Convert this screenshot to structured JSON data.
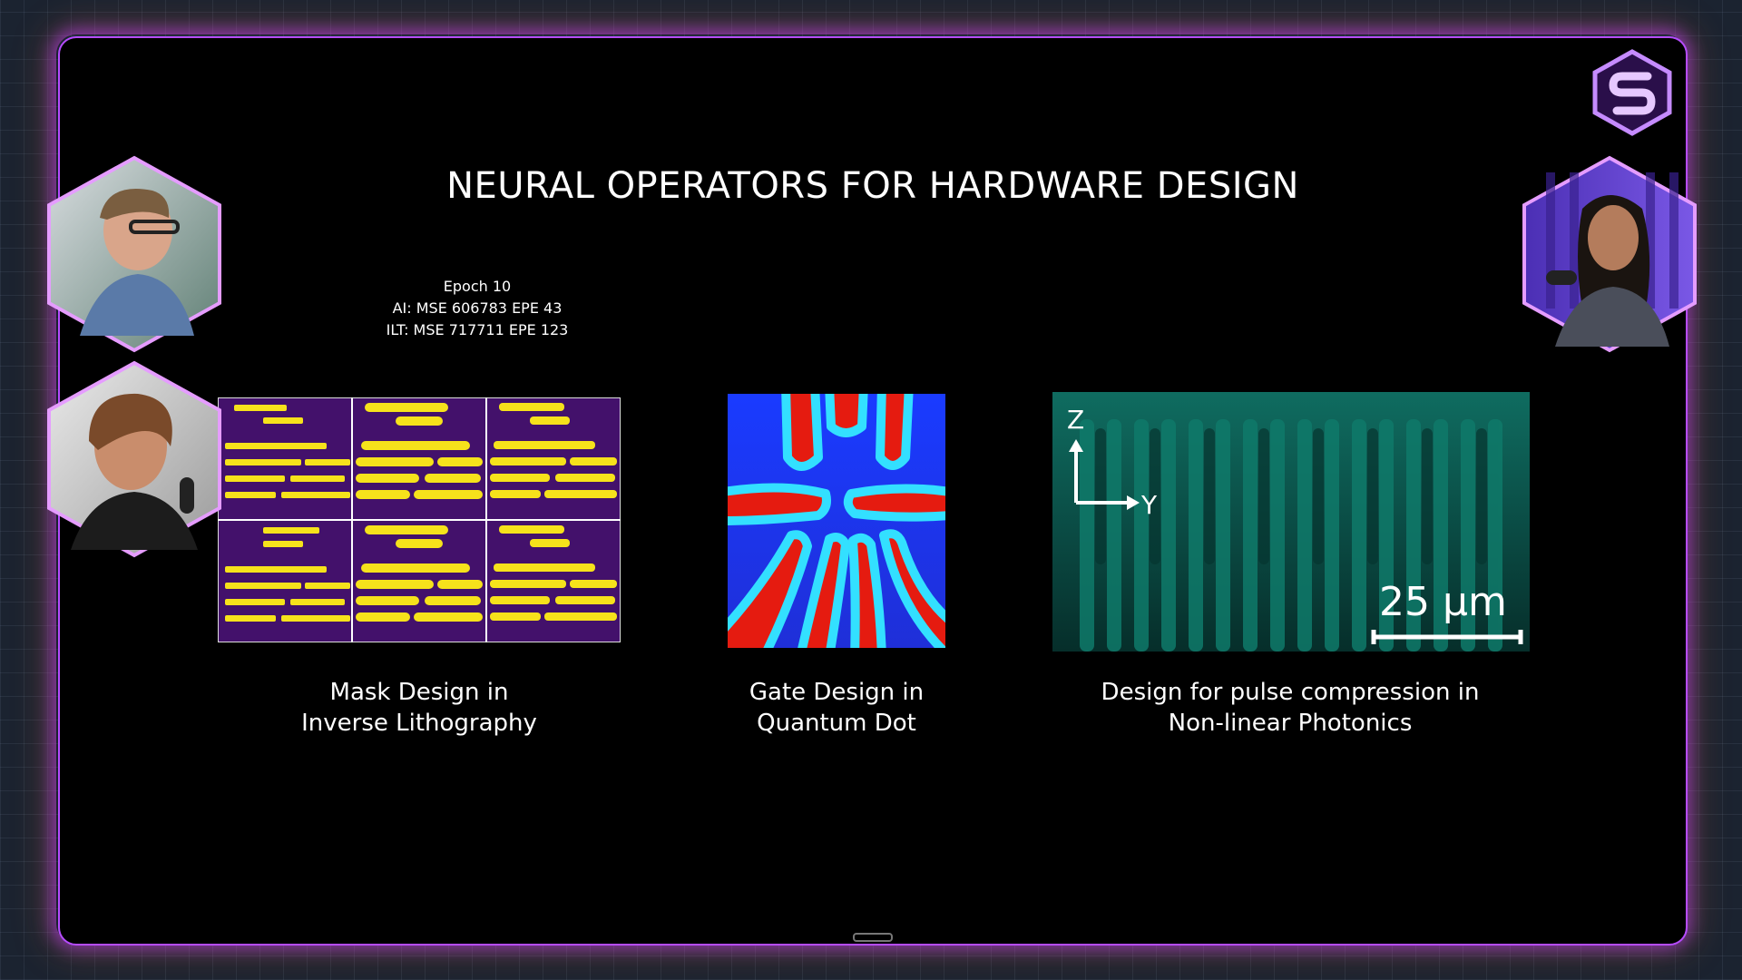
{
  "slide": {
    "title": "NEURAL OPERATORS FOR HARDWARE DESIGN",
    "epoch_info": {
      "line1": "Epoch 10",
      "line2": "AI: MSE 606783 EPE 43",
      "line3": "ILT: MSE 717711 EPE 123"
    },
    "panels": [
      {
        "caption_line1": "Mask Design in",
        "caption_line2": "Inverse Lithography"
      },
      {
        "caption_line1": "Gate Design in",
        "caption_line2": "Quantum Dot"
      },
      {
        "caption_line1": "Design for pulse compression in",
        "caption_line2": "Non-linear Photonics"
      }
    ],
    "photonics": {
      "axis_z": "Z",
      "axis_y": "Y",
      "scale_label": "25 µm"
    }
  },
  "colors": {
    "frame_accent": "#b64cff",
    "mask_background": "#43116b",
    "mask_feature": "#f6e21b",
    "photonics_teal": "#0e6f62"
  },
  "icons": {
    "logo": "hexagon-s-logo-icon"
  }
}
